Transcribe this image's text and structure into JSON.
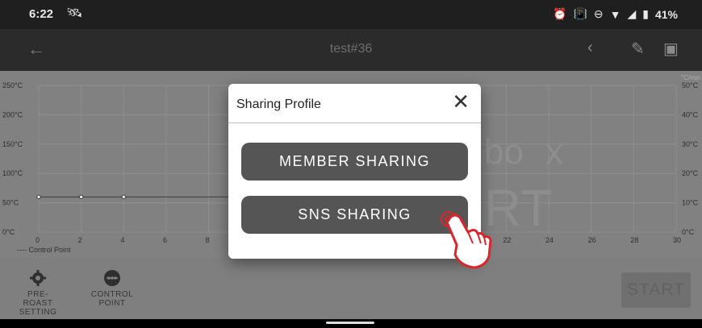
{
  "status_bar": {
    "time": "6:22",
    "left_icon": "satellite-icon",
    "battery": "41%",
    "right_icons": [
      "alarm-icon",
      "vibrate-icon",
      "dnd-icon",
      "wifi-icon",
      "signal-icon",
      "battery-icon"
    ]
  },
  "toolbar": {
    "title": "test#36",
    "icons": [
      "back-arrow-icon",
      "share-icon",
      "edit-icon",
      "export-icon"
    ]
  },
  "chart": {
    "y_left_labels": [
      "250°C",
      "200°C",
      "150°C",
      "100°C",
      "50°C",
      "0°C"
    ],
    "y_right_labels": [
      "50°C",
      "40°C",
      "30°C",
      "20°C",
      "10°C",
      "0°C"
    ],
    "y_right_unit": "°C/min",
    "x_labels_left": [
      "0",
      "2",
      "4",
      "6",
      "8"
    ],
    "x_labels_right": [
      "22",
      "24",
      "26",
      "28",
      "30"
    ],
    "legend": "---- Control Point",
    "watermark_partial": [
      "bo",
      "x",
      "RT"
    ]
  },
  "chart_data": {
    "type": "line",
    "series": [
      {
        "name": "Control Point",
        "x": [
          0,
          2,
          4
        ],
        "y": [
          60,
          60,
          60
        ]
      }
    ],
    "xlim": [
      0,
      30
    ],
    "ylim": [
      0,
      250
    ],
    "grid": true
  },
  "bottom_bar": {
    "pre_roast_label_1": "PRE-ROAST",
    "pre_roast_label_2": "SETTING",
    "control_point_label_1": "CONTROL",
    "control_point_label_2": "POINT",
    "start_label": "START"
  },
  "dialog": {
    "title": "Sharing Profile",
    "close_icon": "close-icon",
    "member_sharing_label": "MEMBER SHARING",
    "sns_sharing_label": "SNS SHARING"
  },
  "colors": {
    "dialog_button": "#555555",
    "chart_bg": "#8c8c8c",
    "hand_outline": "#d8262c"
  }
}
